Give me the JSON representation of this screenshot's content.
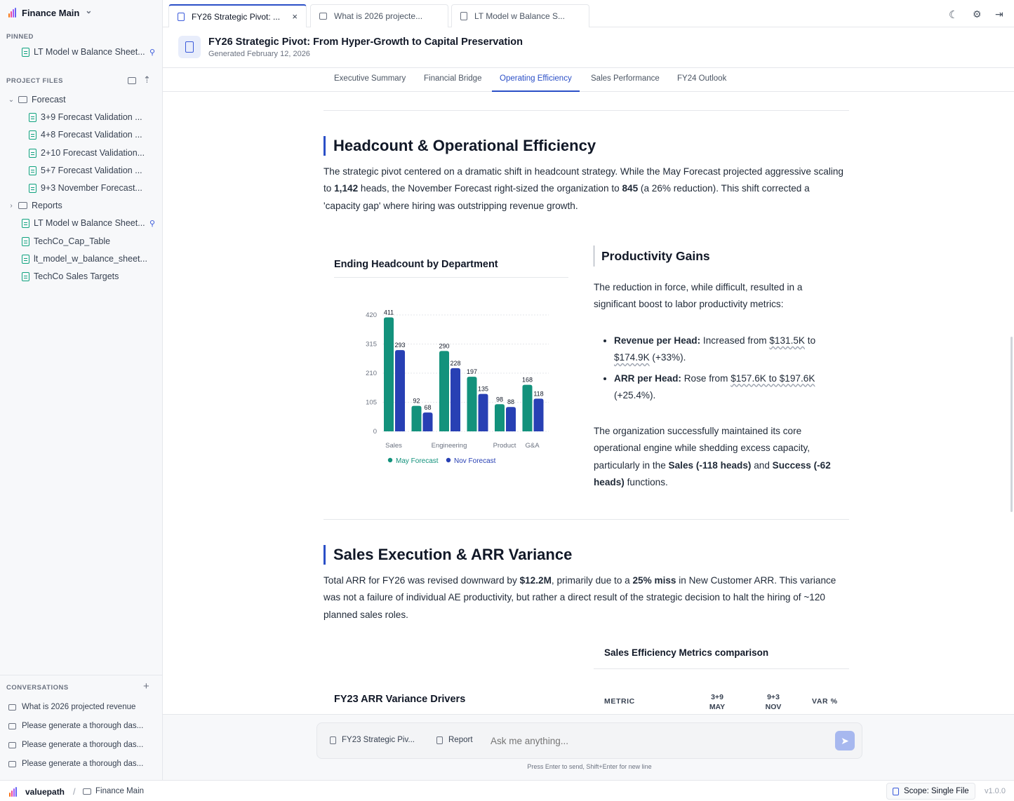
{
  "workspace": {
    "name": "Finance Main"
  },
  "sidebar": {
    "pinned_label": "PINNED",
    "pinned": [
      {
        "label": "LT Model w Balance Sheet..."
      }
    ],
    "project_files_label": "PROJECT FILES",
    "folders": [
      {
        "name": "Forecast",
        "expanded": true,
        "files": [
          "3+9 Forecast Validation ...",
          "4+8 Forecast Validation ...",
          "2+10 Forecast Validation...",
          "5+7 Forecast Validation ...",
          "9+3 November Forecast..."
        ]
      },
      {
        "name": "Reports",
        "expanded": false
      }
    ],
    "root_files": [
      "LT Model w Balance Sheet...",
      "TechCo_Cap_Table",
      "lt_model_w_balance_sheet...",
      "TechCo Sales Targets"
    ],
    "conversations_label": "CONVERSATIONS",
    "conversations": [
      "What is 2026 projected revenue",
      "Please generate a thorough das...",
      "Please generate a thorough das...",
      "Please generate a thorough das..."
    ]
  },
  "tabs": [
    {
      "label": "FY26 Strategic Pivot: ...",
      "active": true,
      "close": "×"
    },
    {
      "label": "What is 2026 projecte...",
      "active": false
    },
    {
      "label": "LT Model w Balance S...",
      "active": false
    }
  ],
  "header": {
    "title": "FY26 Strategic Pivot: From Hyper-Growth to Capital Preservation",
    "subtitle": "Generated February 12, 2026"
  },
  "subnav": [
    "Executive Summary",
    "Financial Bridge",
    "Operating Efficiency",
    "Sales Performance",
    "FY24 Outlook"
  ],
  "subnav_active": "Operating Efficiency",
  "section1": {
    "title": "Headcount & Operational Efficiency",
    "p_a": "The strategic pivot centered on a dramatic shift in headcount strategy. While the May Forecast projected aggressive scaling to ",
    "p_b": "1,142",
    "p_c": " heads, the November Forecast right-sized the organization to ",
    "p_d": "845",
    "p_e": " (a 26% reduction). This shift corrected a 'capacity gap' where hiring was outstripping revenue growth."
  },
  "chart_card": {
    "title": "Ending Headcount by Department"
  },
  "chart_data": {
    "type": "bar",
    "categories": [
      "Sales",
      "",
      "Engineering",
      "",
      "Product",
      "G&A"
    ],
    "series": [
      {
        "name": "May Forecast",
        "values": [
          411,
          92,
          290,
          197,
          98,
          168
        ]
      },
      {
        "name": "Nov Forecast",
        "values": [
          293,
          68,
          228,
          135,
          88,
          118
        ]
      }
    ],
    "yticks": [
      0,
      105,
      210,
      315,
      420
    ],
    "ylim": [
      0,
      430
    ],
    "colors": {
      "May Forecast": "#13927c",
      "Nov Forecast": "#2840b4"
    },
    "legend_position": "bottom"
  },
  "productivity": {
    "title": "Productivity Gains",
    "intro": "The reduction in force, while difficult, resulted in a significant boost to labor productivity metrics:",
    "b1_label": "Revenue per Head:",
    "b1_a": " Increased from ",
    "b1_v1": "$131.5K",
    "b1_b": " to ",
    "b1_v2": "$174.9K",
    "b1_c": " (+33%).",
    "b2_label": "ARR per Head:",
    "b2_a": " Rose from ",
    "b2_v1": "$157.6K to $197.6K",
    "b2_c": " (+25.4%).",
    "out_a": "The organization successfully maintained its core operational engine while shedding excess capacity, particularly in the ",
    "out_b": "Sales (-118 heads)",
    "out_c": " and ",
    "out_d": "Success (-62 heads)",
    "out_e": " functions."
  },
  "section2": {
    "title": "Sales Execution & ARR Variance",
    "p_a": "Total ARR for FY26 was revised downward by ",
    "p_b": "$12.2M",
    "p_c": ", primarily due to a ",
    "p_d": "25% miss",
    "p_e": " in New Customer ARR. This variance was not a failure of individual AE productivity, but rather a direct result of the strategic decision to halt the hiring of ~120 planned sales roles."
  },
  "variance_card": {
    "title": "FY23 ARR Variance Drivers"
  },
  "metrics_table": {
    "title": "Sales Efficiency Metrics comparison",
    "headers": [
      "METRIC",
      "3+9",
      "MAY",
      "9+3",
      "NOV",
      "VAR %"
    ]
  },
  "chat": {
    "chip1": "FY23 Strategic Piv...",
    "chip2": "Report",
    "placeholder": "Ask me anything...",
    "hint": "Press Enter to send, Shift+Enter for new line"
  },
  "footer": {
    "brand": "valuepath",
    "sep": "/",
    "workspace": "Finance Main",
    "scope": "Scope: Single File",
    "version": "v1.0.0"
  },
  "icons": {
    "moon": "☾",
    "gear": "⚙",
    "logout": "⇥",
    "send": "➤",
    "pin": "⚲",
    "plus": "+",
    "chevron_down": "⌄",
    "chevron_right": "›"
  }
}
